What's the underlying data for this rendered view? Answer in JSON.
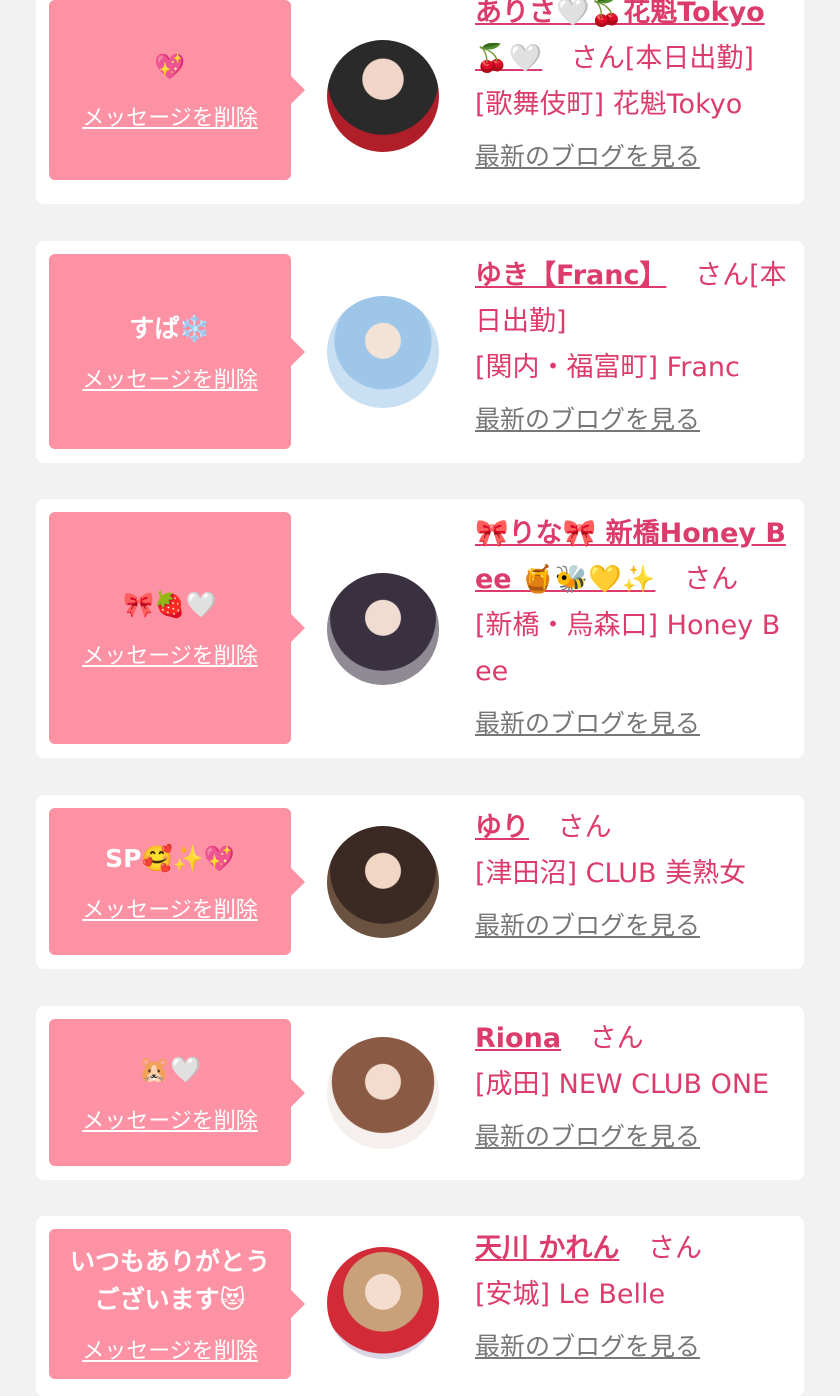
{
  "colors": {
    "accent": "#dc3c6c",
    "bubble": "#fe92a5",
    "background": "#f2f2f2"
  },
  "delete_label": "メッセージを削除",
  "blog_label": "最新のブログを見る",
  "honorific": "さん",
  "cards": [
    {
      "message": "💖",
      "name": "ありさ🤍🍒花魁Tokyo🍒🤍",
      "status": "[本日出勤]",
      "shop": "[歌舞伎町] 花魁Tokyo"
    },
    {
      "message": "すぱ❄️",
      "name": "ゆき【Franc】",
      "status": "[本日出勤]",
      "shop": "[関内・福富町] Franc"
    },
    {
      "message": "🎀🍓🤍",
      "name": "🎀りな🎀 新橋Honey Bee 🍯🐝💛✨",
      "status": "",
      "shop": "[新橋・烏森口] Honey Bee"
    },
    {
      "message": "SP🥰✨💖",
      "name": "ゆり",
      "status": "",
      "shop": "[津田沼] CLUB 美熟女"
    },
    {
      "message": "🐹🤍",
      "name": "Riona",
      "status": "",
      "shop": "[成田] NEW CLUB ONE"
    },
    {
      "message": "いつもありがとうございます😻",
      "name": "天川 かれん",
      "status": "",
      "shop": "[安城] Le Belle"
    }
  ]
}
